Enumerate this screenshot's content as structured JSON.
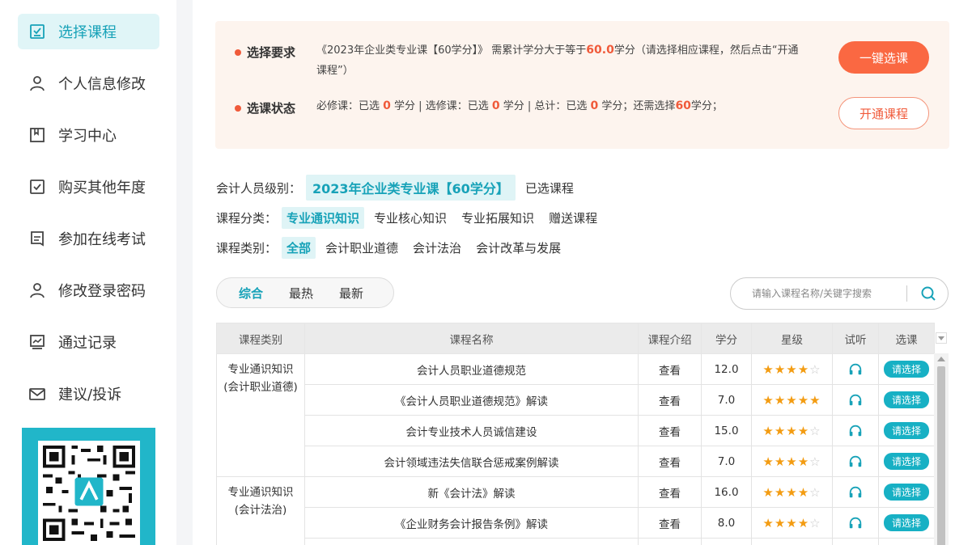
{
  "sidebar": {
    "items": [
      {
        "label": "选择课程",
        "icon": "checklist-icon",
        "active": true
      },
      {
        "label": "个人信息修改",
        "icon": "user-icon"
      },
      {
        "label": "学习中心",
        "icon": "bookmark-icon"
      },
      {
        "label": "购买其他年度",
        "icon": "checkbox-icon"
      },
      {
        "label": "参加在线考试",
        "icon": "document-icon"
      },
      {
        "label": "修改登录密码",
        "icon": "user-lock-icon"
      },
      {
        "label": "通过记录",
        "icon": "chart-icon"
      },
      {
        "label": "建议/投诉",
        "icon": "mail-icon"
      }
    ],
    "qr_code": "qr-code-image"
  },
  "requirement": {
    "label1": "选择要求",
    "text1_a": "《2023年企业类专业课【60学分】》 需累计学分大于等于",
    "text1_value": "60.0",
    "text1_b": "学分（请选择相应课程，然后点击“开通课程”）",
    "label2": "选课状态",
    "s_req": "必修课：已选",
    "s_req_v": "0",
    "s_elec": "学分 | 选修课：已选",
    "s_elec_v": "0",
    "s_total": "学分 | 总计：已选",
    "s_total_v": "0",
    "s_need": "学分；还需选择",
    "s_need_v": "60",
    "s_end": "学分；",
    "btn_one_click": "一键选课",
    "btn_open": "开通课程"
  },
  "filters": {
    "level_label": "会计人员级别：",
    "level_value": "2023年企业类专业课【60学分】",
    "selected_courses": "已选课程",
    "category_label": "课程分类：",
    "categories": [
      "专业通识知识",
      "专业核心知识",
      "专业拓展知识",
      "赠送课程"
    ],
    "type_label": "课程类别：",
    "types": [
      "全部",
      "会计职业道德",
      "会计法治",
      "会计改革与发展"
    ]
  },
  "sort": {
    "tabs": [
      "综合",
      "最热",
      "最新"
    ]
  },
  "search": {
    "placeholder": "请输入课程名称/关键字搜索"
  },
  "table": {
    "headers": [
      "课程类别",
      "课程名称",
      "课程介绍",
      "学分",
      "星级",
      "试听",
      "选课"
    ],
    "groups": [
      {
        "category": "专业通识知识\n(会计职业道德)",
        "category_l1": "专业通识知识",
        "category_l2": "(会计职业道德)",
        "rows": [
          {
            "name": "会计人员职业道德规范",
            "intro": "查看",
            "credit": "12.0",
            "stars": 4,
            "pick": "请选择"
          },
          {
            "name": "《会计人员职业道德规范》解读",
            "intro": "查看",
            "credit": "7.0",
            "stars": 5,
            "pick": "请选择"
          },
          {
            "name": "会计专业技术人员诚信建设",
            "intro": "查看",
            "credit": "15.0",
            "stars": 4,
            "pick": "请选择"
          },
          {
            "name": "会计领域违法失信联合惩戒案例解读",
            "intro": "查看",
            "credit": "7.0",
            "stars": 4,
            "pick": "请选择"
          }
        ]
      },
      {
        "category": "专业通识知识\n(会计法治)",
        "category_l1": "专业通识知识",
        "category_l2": "(会计法治)",
        "rows": [
          {
            "name": "新《会计法》解读",
            "intro": "查看",
            "credit": "16.0",
            "stars": 4,
            "pick": "请选择"
          },
          {
            "name": "《企业财务会计报告条例》解读",
            "intro": "查看",
            "credit": "8.0",
            "stars": 4,
            "pick": "请选择"
          },
          {
            "name": "",
            "intro": "",
            "credit": "",
            "stars": 0,
            "pick": ""
          }
        ]
      }
    ]
  },
  "colors": {
    "accent": "#17a2b8",
    "orange": "#fa6842",
    "star": "#f39c12"
  }
}
